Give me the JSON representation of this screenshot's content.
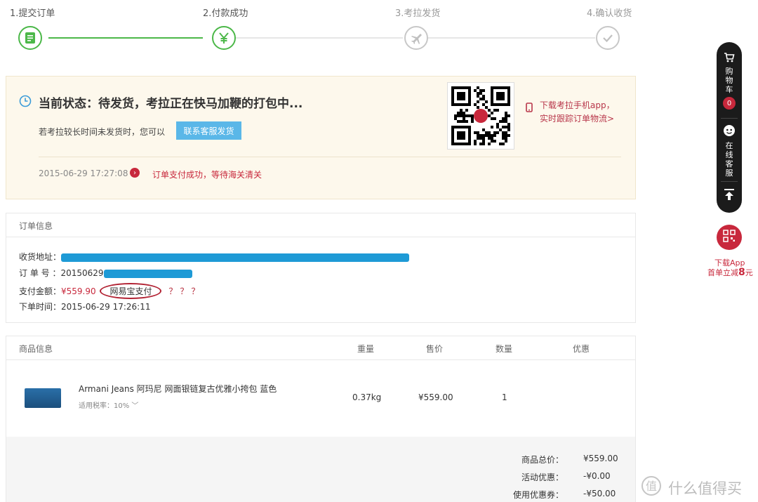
{
  "steps": [
    {
      "label": "1.提交订单",
      "status": "done",
      "icon": "receipt-icon"
    },
    {
      "label": "2.付款成功",
      "status": "done",
      "icon": "yen-icon"
    },
    {
      "label": "3.考拉发货",
      "status": "todo",
      "icon": "plane-icon"
    },
    {
      "label": "4.确认收货",
      "status": "todo",
      "icon": "check-icon"
    }
  ],
  "status": {
    "title": "当前状态：待发货，考拉正在快马加鞭的打包中...",
    "hint": "若考拉较长时间未发货时，您可以",
    "contact_button": "联系客服发货",
    "time": "2015-06-29 17:27:08",
    "message": "订单支付成功，等待海关清关",
    "app_line1": "下载考拉手机app，",
    "app_line2": "实时跟踪订单物流>"
  },
  "order_info": {
    "heading": "订单信息",
    "address_label": "收货地址：",
    "order_no_label": "订 单 号 ：",
    "order_no_prefix": "20150629",
    "amount_label": "支付金额：",
    "amount": "¥559.90",
    "pay_method": "网易宝支付",
    "pay_note": "？？？",
    "time_label": "下单时间：",
    "order_time": "2015-06-29 17:26:11"
  },
  "products": {
    "headers": {
      "info": "商品信息",
      "weight": "重量",
      "price": "售价",
      "qty": "数量",
      "discount": "优惠"
    },
    "rows": [
      {
        "name": "Armani Jeans 阿玛尼 网面银链复古优雅小挎包 蓝色",
        "tax": "适用税率：10%",
        "weight": "0.37kg",
        "price": "¥559.00",
        "qty": "1"
      }
    ]
  },
  "summary": [
    {
      "label": "商品总价：",
      "value": "¥559.00"
    },
    {
      "label": "活动优惠：",
      "value": "-¥0.00"
    },
    {
      "label": "使用优惠券：",
      "value": "-¥50.00"
    }
  ],
  "sidebar": {
    "cart_label": "购物车",
    "cart_count": "0",
    "service_label": "在线客服",
    "download_app": "下载App",
    "promo_prefix": "首单立减",
    "promo_amount": "8",
    "promo_suffix": "元"
  },
  "watermark": "什么值得买",
  "colors": {
    "green": "#4cb849",
    "red": "#c8283c",
    "blue": "#5ab7e8"
  }
}
